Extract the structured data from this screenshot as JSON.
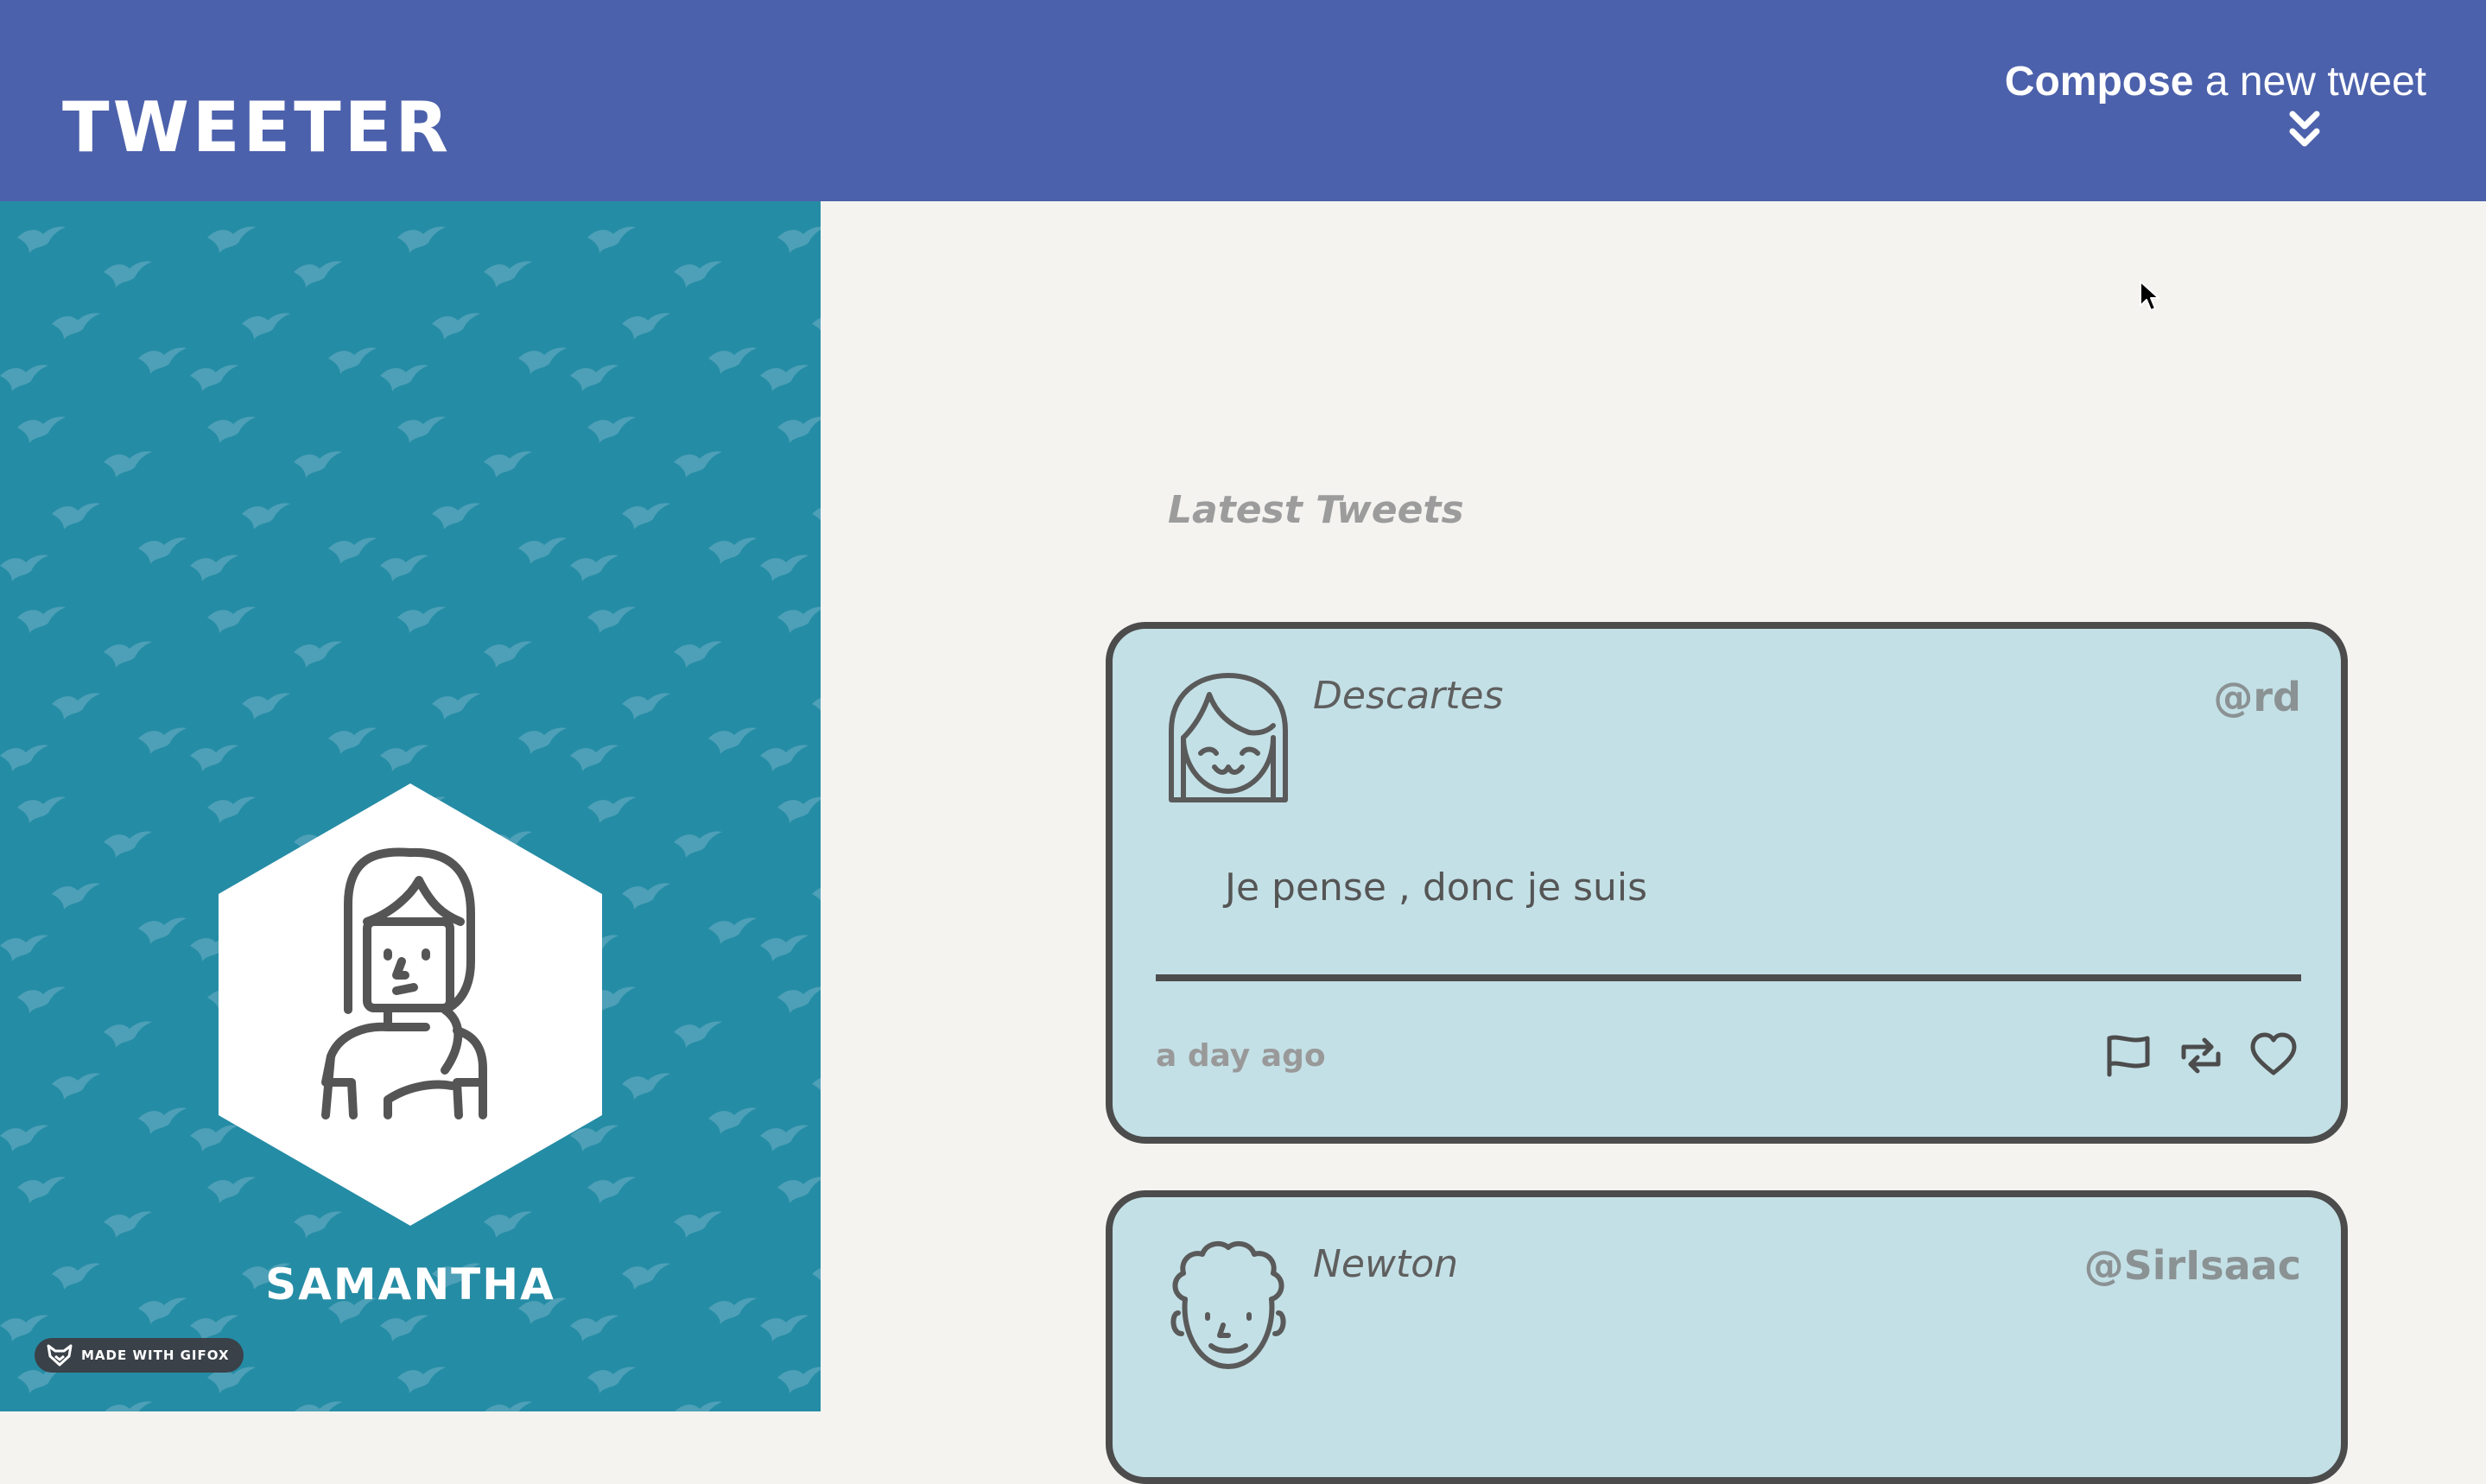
{
  "header": {
    "logo": "TWEETER",
    "compose_bold": "Compose",
    "compose_rest": "a new tweet",
    "compose_icon": "chevron-double-down-icon"
  },
  "sidebar": {
    "username": "SAMANTHA",
    "badge": "MADE WITH GIFOX",
    "background_color": "#258ca5",
    "pattern_icon": "bird-icon"
  },
  "feed": {
    "heading": "Latest Tweets",
    "tweets": [
      {
        "name": "Descartes",
        "handle": "@rd",
        "body": "Je pense , donc je suis",
        "time": "a day ago",
        "actions": [
          "flag-icon",
          "retweet-icon",
          "heart-icon"
        ]
      },
      {
        "name": "Newton",
        "handle": "@SirIsaac"
      }
    ]
  },
  "colors": {
    "header": "#4c61ab",
    "page_background": "#f4f3f0",
    "tweet_background": "#c3e0e6",
    "tweet_border": "#4c4c4c"
  }
}
